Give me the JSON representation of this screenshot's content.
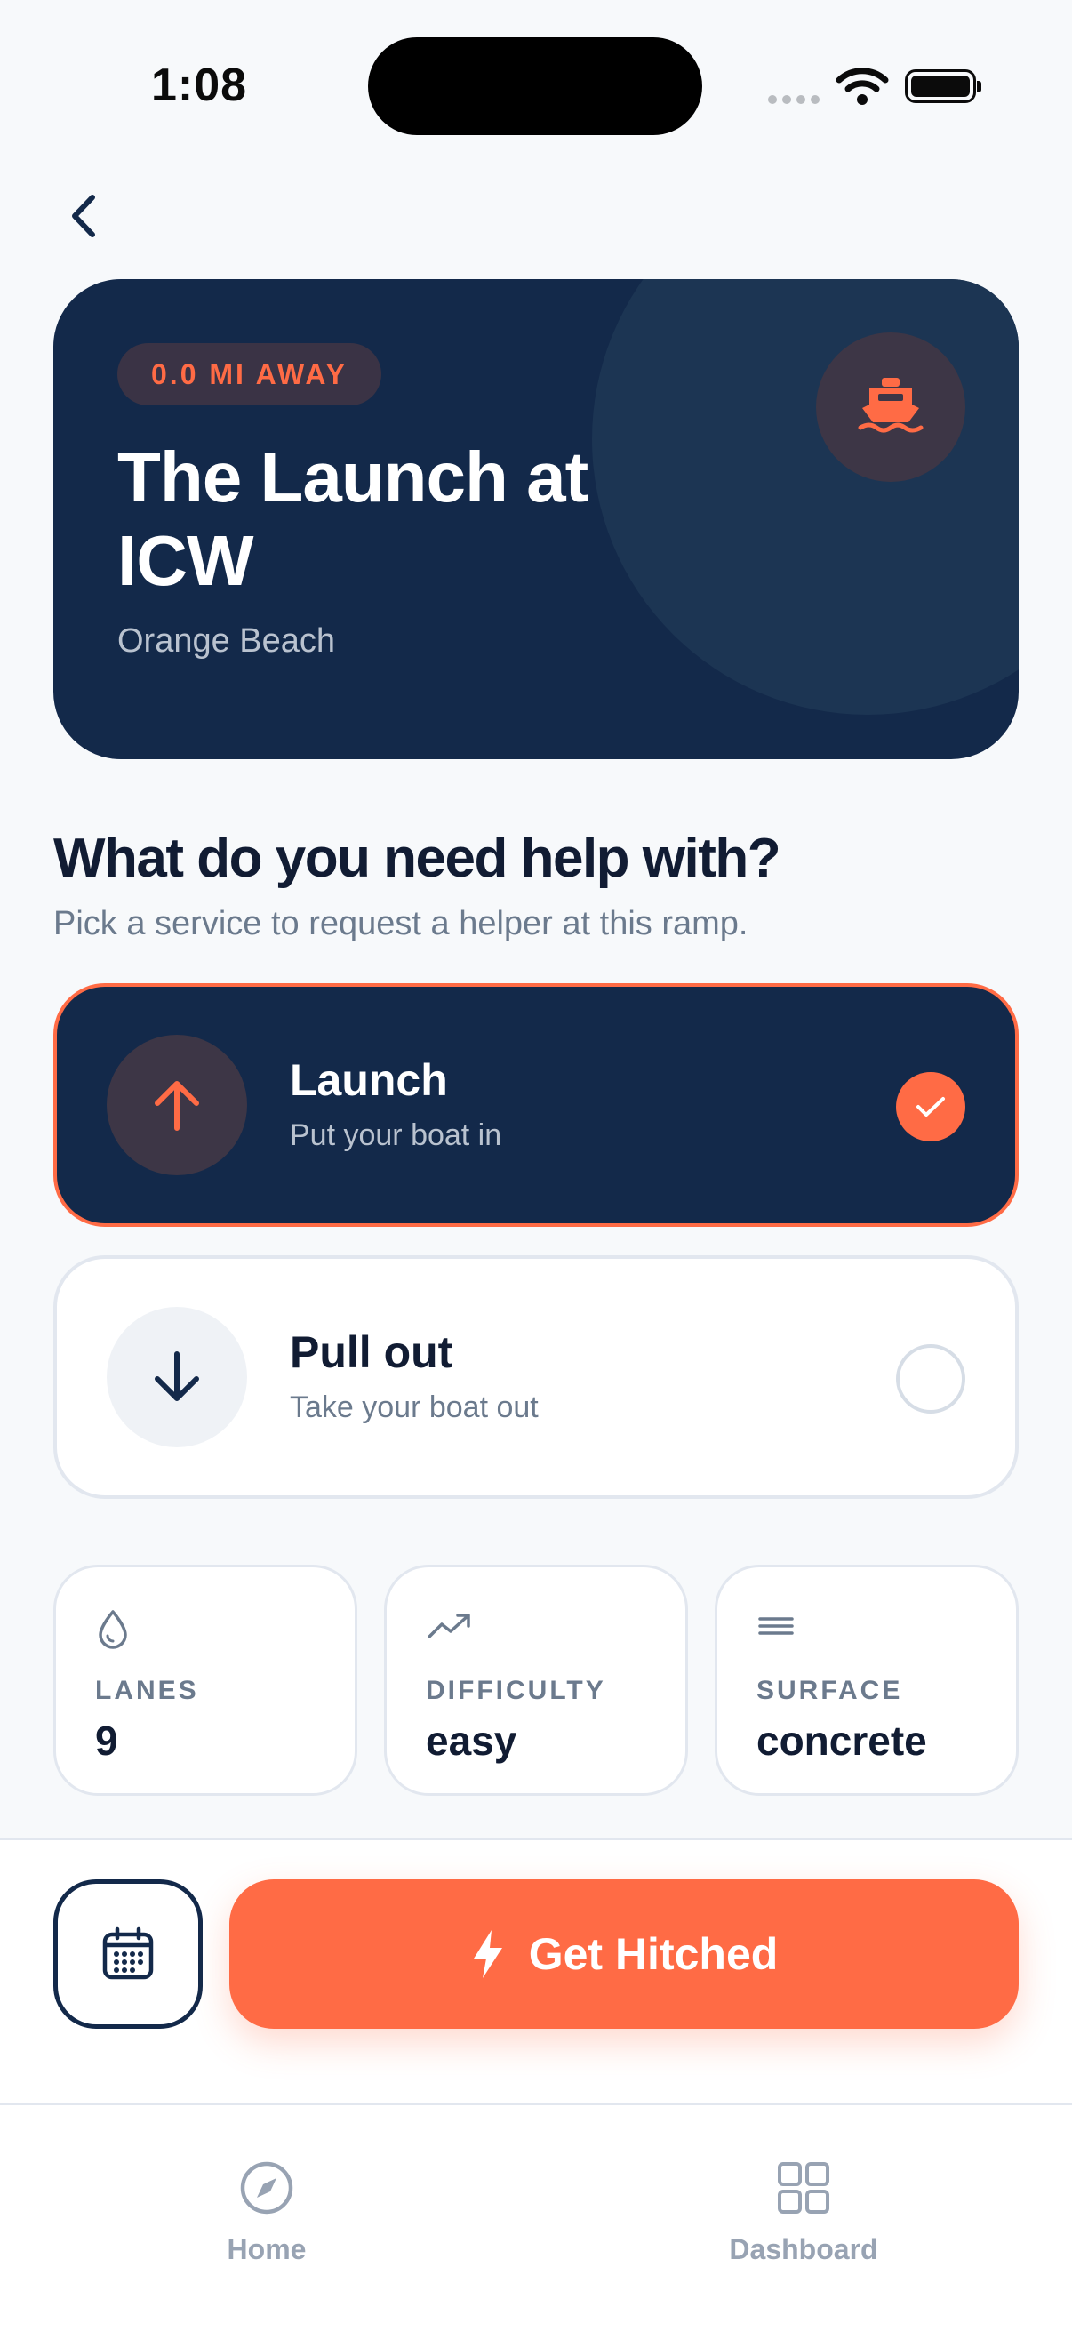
{
  "status_bar": {
    "time": "1:08"
  },
  "hero": {
    "distance_badge": "0.0 MI AWAY",
    "title": "The Launch at ICW",
    "subtitle": "Orange Beach",
    "icon": "boat-icon"
  },
  "prompt": {
    "title": "What do you need help with?",
    "subtitle": "Pick a service to request a helper at this ramp."
  },
  "services": [
    {
      "title": "Launch",
      "subtitle": "Put your boat in",
      "icon": "arrow-up-icon",
      "selected": true
    },
    {
      "title": "Pull out",
      "subtitle": "Take your boat out",
      "icon": "arrow-down-icon",
      "selected": false
    }
  ],
  "stats": [
    {
      "label": "LANES",
      "value": "9",
      "icon": "water-drop-icon"
    },
    {
      "label": "DIFFICULTY",
      "value": "easy",
      "icon": "trending-up-icon"
    },
    {
      "label": "SURFACE",
      "value": "concrete",
      "icon": "lines-icon"
    }
  ],
  "actions": {
    "schedule_icon": "calendar-icon",
    "cta_label": "Get Hitched",
    "cta_icon": "lightning-icon"
  },
  "tabs": [
    {
      "label": "Home",
      "icon": "compass-icon"
    },
    {
      "label": "Dashboard",
      "icon": "grid-icon"
    }
  ],
  "colors": {
    "navy": "#13294a",
    "accent": "#ff6b45",
    "muted": "#6b7a8d",
    "background": "#f7f9fb"
  }
}
